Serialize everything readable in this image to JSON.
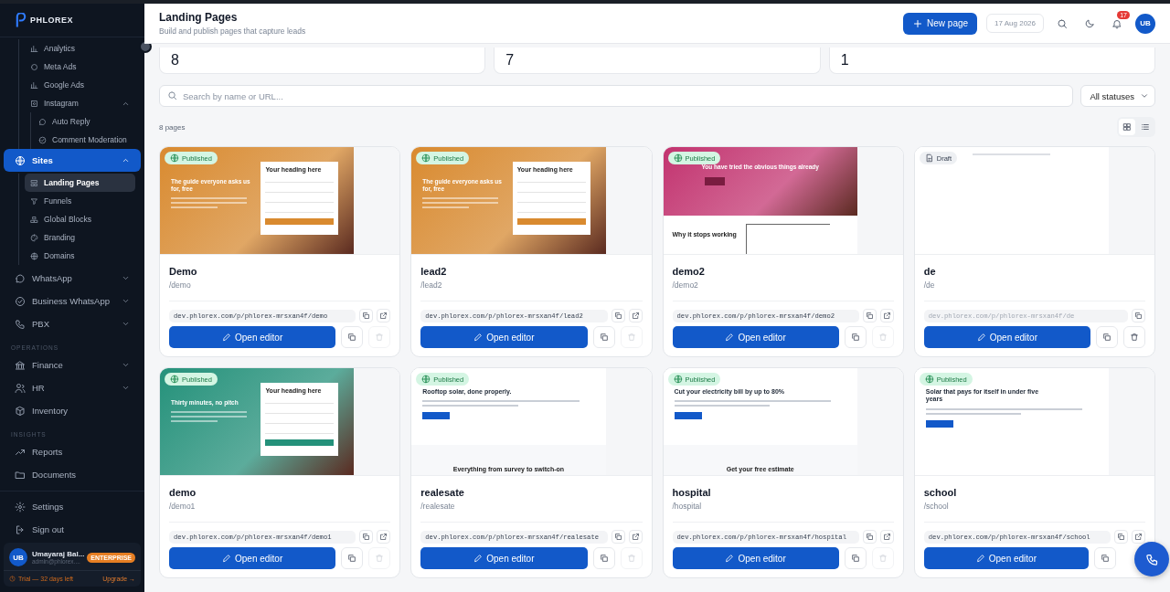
{
  "brand": {
    "name": "PHLOREX"
  },
  "sidebar": {
    "nav": [
      {
        "kind": "group",
        "children": [
          {
            "label": "Analytics",
            "selected": false
          },
          {
            "label": "Meta Ads",
            "selected": false
          },
          {
            "label": "Google Ads",
            "selected": false
          },
          {
            "label": "Instagram",
            "selected": false,
            "expanded": true,
            "children": [
              {
                "label": "Auto Reply",
                "selected": false
              },
              {
                "label": "Comment Moderation",
                "selected": false
              }
            ]
          }
        ]
      },
      {
        "kind": "item",
        "label": "Sites",
        "selected": true,
        "expanded": true,
        "children": [
          {
            "label": "Landing Pages",
            "selected": true
          },
          {
            "label": "Funnels",
            "selected": false
          },
          {
            "label": "Global Blocks",
            "selected": false
          },
          {
            "label": "Branding",
            "selected": false
          },
          {
            "label": "Domains",
            "selected": false
          }
        ]
      },
      {
        "kind": "item",
        "label": "WhatsApp",
        "selected": false,
        "expanded": false
      },
      {
        "kind": "item",
        "label": "Business WhatsApp",
        "selected": false,
        "expanded": false
      },
      {
        "kind": "item",
        "label": "PBX",
        "selected": false,
        "expanded": false
      },
      {
        "kind": "section",
        "label": "OPERATIONS"
      },
      {
        "kind": "item",
        "label": "Finance",
        "selected": false,
        "expanded": false
      },
      {
        "kind": "item",
        "label": "HR",
        "selected": false,
        "expanded": false
      },
      {
        "kind": "item",
        "label": "Inventory",
        "selected": false
      },
      {
        "kind": "section",
        "label": "INSIGHTS"
      },
      {
        "kind": "item",
        "label": "Reports",
        "selected": false
      },
      {
        "kind": "item",
        "label": "Documents",
        "selected": false
      }
    ],
    "footer_items": [
      {
        "label": "Settings"
      },
      {
        "label": "Sign out"
      }
    ],
    "user": {
      "initials": "UB",
      "name": "Umayaraj Bal...",
      "email": "admin@phlorex....",
      "plan": "ENTERPRISE",
      "trial": "Trial — 32 days left",
      "upgrade": "Upgrade →"
    }
  },
  "header": {
    "title": "Landing Pages",
    "subtitle": "Build and publish pages that capture leads",
    "new_button": "New page",
    "date": "17 Aug 2026",
    "notifications": "17",
    "avatar": "UB"
  },
  "stats": [
    {
      "value": "8"
    },
    {
      "value": "7"
    },
    {
      "value": "1"
    }
  ],
  "search": {
    "placeholder": "Search by name or URL..."
  },
  "status_filter": "All statuses",
  "count": "8 pages",
  "view_modes": [
    {
      "kind": "grid",
      "selected": true
    },
    {
      "kind": "list",
      "selected": false
    }
  ],
  "pages": [
    {
      "name": "Demo",
      "slug": "/demo",
      "url": "dev.phlorex.com/p/phlorex-mrsxan4f/demo",
      "published": true,
      "status_label": "Published",
      "delete_disabled": true,
      "button": "Open editor",
      "thumbnail": {
        "kind": "form",
        "color": "#d98a2f",
        "headline": "The guide everyone asks us for, free",
        "form_title": "Your heading here"
      }
    },
    {
      "name": "lead2",
      "slug": "/lead2",
      "url": "dev.phlorex.com/p/phlorex-mrsxan4f/lead2",
      "published": true,
      "status_label": "Published",
      "delete_disabled": true,
      "button": "Open editor",
      "thumbnail": {
        "kind": "form",
        "color": "#d98a2f",
        "headline": "The guide everyone asks us for, free",
        "form_title": "Your heading here"
      }
    },
    {
      "name": "demo2",
      "slug": "/demo2",
      "url": "dev.phlorex.com/p/phlorex-mrsxan4f/demo2",
      "published": true,
      "status_label": "Published",
      "delete_disabled": true,
      "button": "Open editor",
      "thumbnail": {
        "kind": "hero",
        "color": "#c2336f",
        "headline": "You have tried the obvious things already",
        "section": "Why it stops working"
      }
    },
    {
      "name": "de",
      "slug": "/de",
      "url": "dev.phlorex.com/p/phlorex-mrsxan4f/de",
      "published": false,
      "status_label": "Draft",
      "delete_disabled": false,
      "button": "Open editor",
      "thumbnail": {
        "kind": "blank"
      }
    },
    {
      "name": "demo",
      "slug": "/demo1",
      "url": "dev.phlorex.com/p/phlorex-mrsxan4f/demo1",
      "published": true,
      "status_label": "Published",
      "delete_disabled": true,
      "button": "Open editor",
      "thumbnail": {
        "kind": "form",
        "color": "#24917a",
        "headline": "Thirty minutes, no pitch",
        "form_title": "Your heading here"
      }
    },
    {
      "name": "realesate",
      "slug": "/realesate",
      "url": "dev.phlorex.com/p/phlorex-mrsxan4f/realesate",
      "published": true,
      "status_label": "Published",
      "delete_disabled": true,
      "button": "Open editor",
      "thumbnail": {
        "kind": "landing",
        "headline": "Rooftop solar, done properly.",
        "section": "Everything from survey to switch-on"
      }
    },
    {
      "name": "hospital",
      "slug": "/hospital",
      "url": "dev.phlorex.com/p/phlorex-mrsxan4f/hospital",
      "published": true,
      "status_label": "Published",
      "delete_disabled": true,
      "button": "Open editor",
      "thumbnail": {
        "kind": "landing",
        "headline": "Cut your electricity bill by up to 80%",
        "section": "Get your free estimate"
      }
    },
    {
      "name": "school",
      "slug": "/school",
      "url": "dev.phlorex.com/p/phlorex-mrsxan4f/school",
      "published": true,
      "status_label": "Published",
      "button": "Open editor",
      "thumbnail": {
        "kind": "landing",
        "headline": "Solar that pays for itself in under five years"
      }
    }
  ]
}
